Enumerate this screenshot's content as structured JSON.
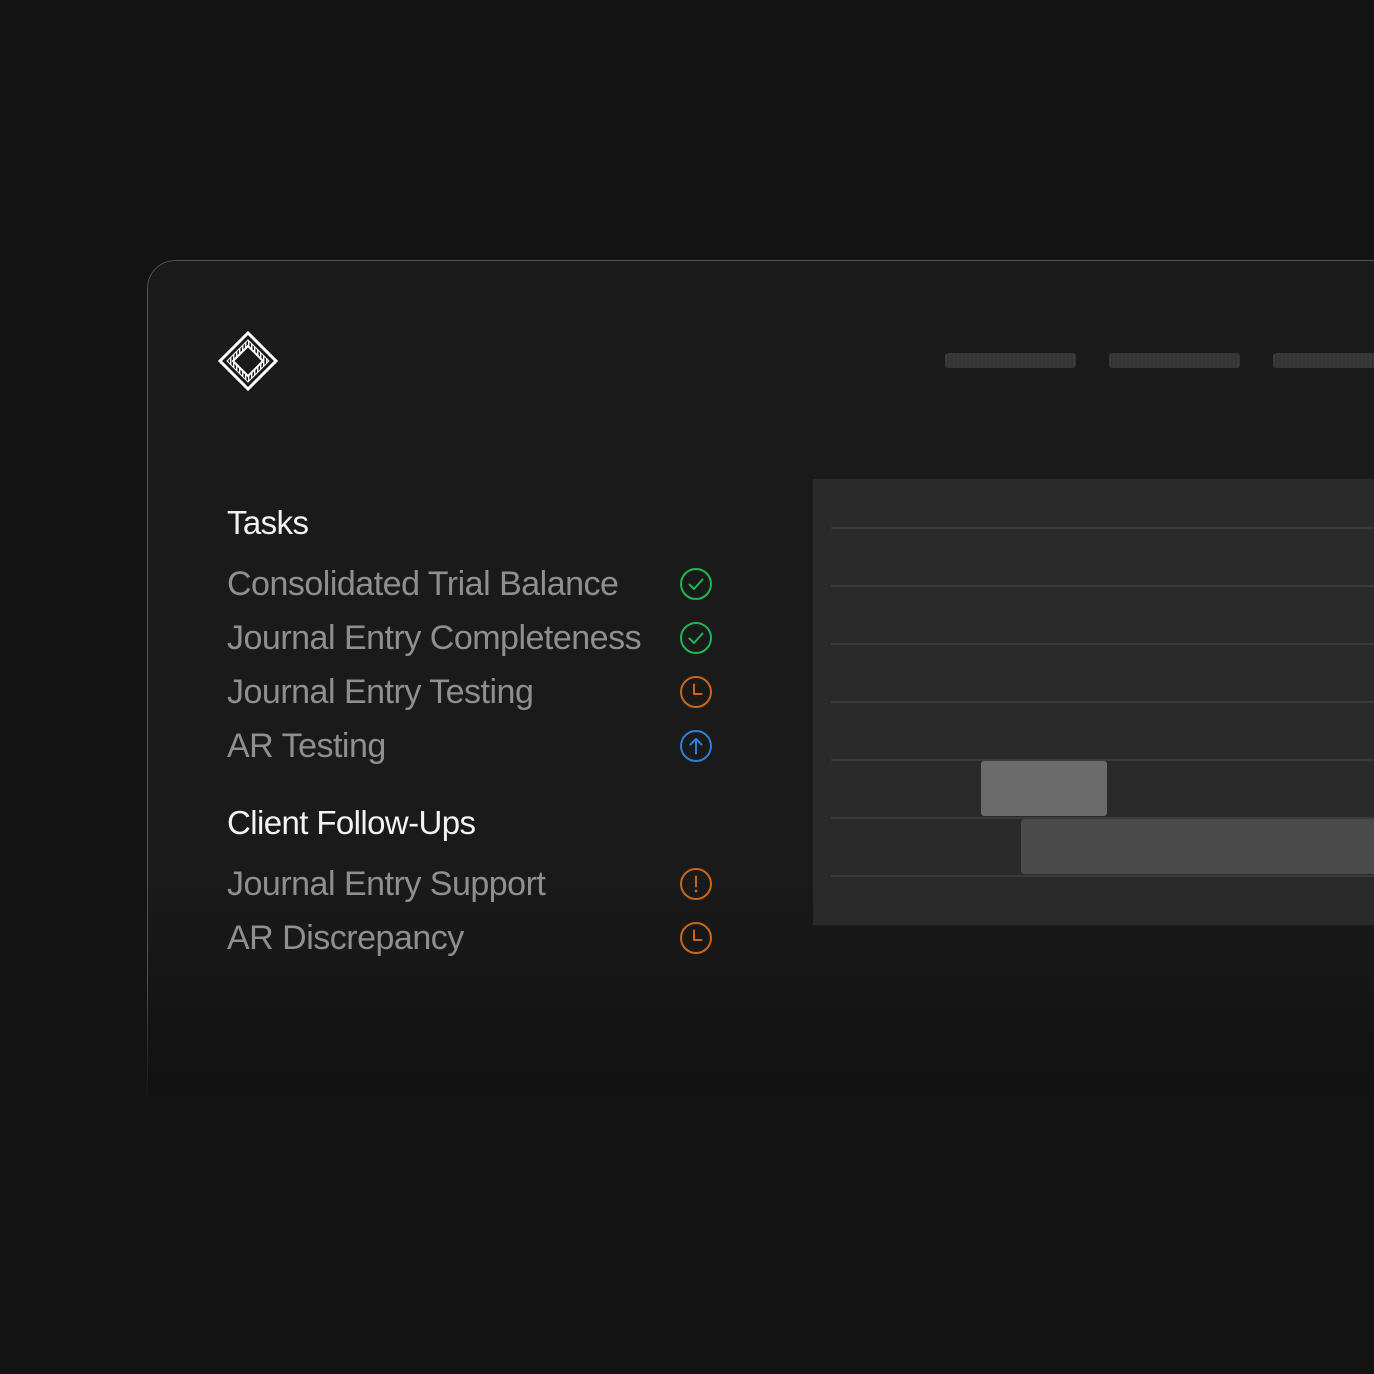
{
  "sections": {
    "tasks": {
      "title": "Tasks",
      "items": [
        {
          "label": "Consolidated Trial Balance",
          "status_icon": "check-circle-icon",
          "color": "#22b455"
        },
        {
          "label": "Journal Entry Completeness",
          "status_icon": "check-circle-icon",
          "color": "#22b455"
        },
        {
          "label": "Journal Entry Testing",
          "status_icon": "clock-icon",
          "color": "#c9661c"
        },
        {
          "label": "AR Testing",
          "status_icon": "arrow-up-circle-icon",
          "color": "#2c7fd6"
        }
      ]
    },
    "followups": {
      "title": "Client Follow-Ups",
      "items": [
        {
          "label": "Journal Entry Support",
          "status_icon": "alert-circle-icon",
          "color": "#c9661c"
        },
        {
          "label": "AR Discrepancy",
          "status_icon": "clock-icon",
          "color": "#c9661c"
        }
      ]
    }
  },
  "colors": {
    "background": "#131313",
    "window": "#1a1a1a",
    "panel": "#2a2a2a",
    "success": "#22b455",
    "pending": "#c9661c",
    "info": "#2c7fd6"
  }
}
